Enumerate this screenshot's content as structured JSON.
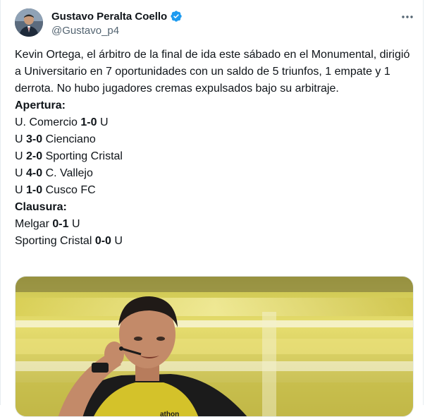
{
  "author": {
    "name": "Gustavo Peralta Coello",
    "handle": "@Gustavo_p4",
    "verified": true,
    "avatar_icon": "profile-photo"
  },
  "tweet": {
    "text": "Kevin Ortega, el árbitro de la final de ida este sábado en el Monumental, dirigió a Universitario en 7 oportunidades con un saldo de 5 triunfos, 1 empate y 1 derrota. No hubo jugadores cremas expulsados bajo su arbitraje.",
    "apertura_heading": "Apertura:",
    "apertura": [
      {
        "home": "U. Comercio",
        "score": "1-0",
        "away": "U"
      },
      {
        "home": "U",
        "score": "3-0",
        "away": "Cienciano"
      },
      {
        "home": "U",
        "score": "2-0",
        "away": "Sporting Cristal"
      },
      {
        "home": "U",
        "score": "4-0",
        "away": "C. Vallejo"
      },
      {
        "home": "U",
        "score": "1-0",
        "away": "Cusco FC"
      }
    ],
    "clausura_heading": "Clausura:",
    "clausura": [
      {
        "home": "Melgar",
        "score": "0-1",
        "away": "U"
      },
      {
        "home": "Sporting Cristal",
        "score": "0-0",
        "away": "U"
      }
    ]
  },
  "media": {
    "description_icon": "referee-photo",
    "shirt_text": "athon"
  },
  "colors": {
    "verified_blue": "#1d9bf0",
    "secondary_text": "#536471",
    "jersey_yellow": "#d4c22a"
  }
}
